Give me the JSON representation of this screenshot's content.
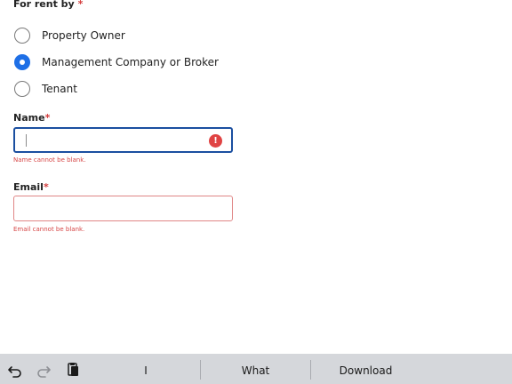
{
  "form": {
    "rent_by": {
      "title": "For rent by",
      "required_mark": "*",
      "options": [
        {
          "label": "Property Owner",
          "selected": false
        },
        {
          "label": "Management Company or Broker",
          "selected": true
        },
        {
          "label": "Tenant",
          "selected": false
        }
      ]
    },
    "name": {
      "label": "Name",
      "required_mark": "*",
      "value": "",
      "error": "Name cannot be blank.",
      "alert_icon": "exclamation-circle-icon",
      "alert_glyph": "!"
    },
    "email": {
      "label": "Email",
      "required_mark": "*",
      "value": "",
      "error": "Email cannot be blank."
    }
  },
  "keyboard_bar": {
    "icons": [
      "undo-icon",
      "redo-icon",
      "paste-icon"
    ],
    "suggestions": [
      "I",
      "What",
      "Download"
    ]
  },
  "colors": {
    "accent": "#1e6fe6",
    "focus_border": "#1b4fa0",
    "error": "#d64545",
    "keyboard_bar": "#d5d7db"
  }
}
